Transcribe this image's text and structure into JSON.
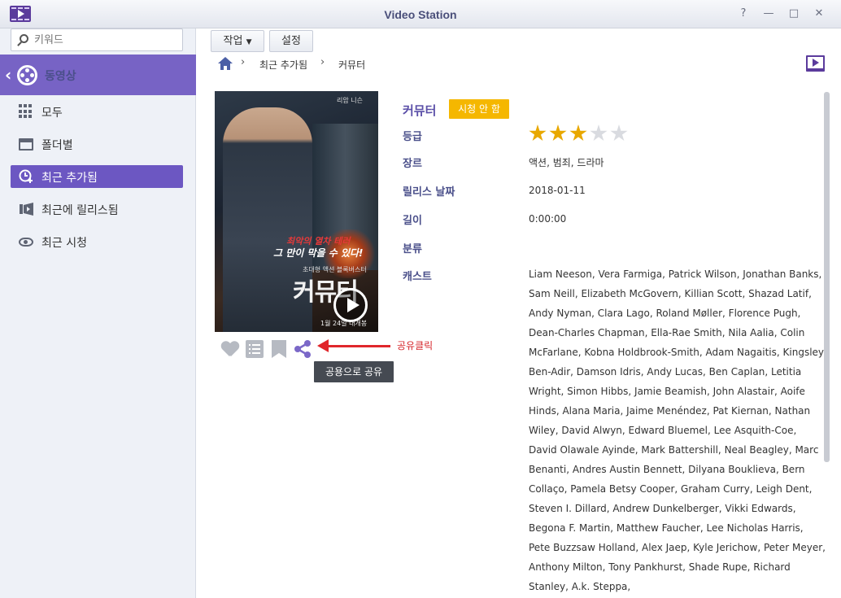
{
  "window": {
    "title": "Video Station",
    "controls": [
      "?",
      "—",
      "□",
      "✕"
    ]
  },
  "sidebar": {
    "search_placeholder": "키워드",
    "library": "동영상",
    "items": [
      {
        "label": "모두",
        "icon": "grid-icon",
        "active": false
      },
      {
        "label": "폴더별",
        "icon": "folder-icon",
        "active": false
      },
      {
        "label": "최근 추가됨",
        "icon": "recently-added-icon",
        "active": true
      },
      {
        "label": "최근에 릴리스됨",
        "icon": "recently-released-icon",
        "active": false
      },
      {
        "label": "최근 시청",
        "icon": "eye-icon",
        "active": false
      }
    ]
  },
  "toolbar": {
    "action_label": "작업",
    "settings_label": "설정"
  },
  "breadcrumb": {
    "items": [
      "최근 추가됨",
      "커뮤터"
    ]
  },
  "poster": {
    "cast_top": "리암 니슨",
    "tagline1": "최악의 열차 테러",
    "tagline2": "그 만이 막을 수 있다!",
    "tagline3": "초대형 액션 블록버스터",
    "title": "커뮤터",
    "release_note": "1월 24일 대개봉"
  },
  "actions": {
    "tooltip": "공용으로 공유",
    "annotation": "공유클릭"
  },
  "movie": {
    "title": "커뮤터",
    "watch_status": "시청 안 함",
    "rating": 3,
    "rating_max": 5,
    "labels": {
      "rating": "등급",
      "genre": "장르",
      "release_date": "릴리스 날짜",
      "length": "길이",
      "classification": "분류",
      "cast": "캐스트"
    },
    "genre": "액션, 범죄, 드라마",
    "release_date": "2018-01-11",
    "length": "0:00:00",
    "classification": "",
    "cast": "Liam Neeson, Vera Farmiga, Patrick Wilson, Jonathan Banks, Sam Neill, Elizabeth McGovern, Killian Scott, Shazad Latif, Andy Nyman, Clara Lago, Roland Møller, Florence Pugh, Dean-Charles Chapman, Ella-Rae Smith, Nila Aalia, Colin McFarlane, Kobna Holdbrook-Smith, Adam Nagaitis, Kingsley Ben-Adir, Damson Idris, Andy Lucas, Ben Caplan, Letitia Wright, Simon Hibbs, Jamie Beamish, John Alastair, Aoife Hinds, Alana Maria, Jaime Menéndez, Pat Kiernan, Nathan Wiley, David Alwyn, Edward Bluemel, Lee Asquith-Coe, David Olawale Ayinde, Mark Battershill, Neal Beagley, Marc Benanti, Andres Austin Bennett, Dilyana Bouklieva, Bern Collaço, Pamela Betsy Cooper, Graham Curry, Leigh Dent, Steven I. Dillard, Andrew Dunkelberger, Vikki Edwards, Begona F. Martin, Matthew Faucher, Lee Nicholas Harris, Pete Buzzsaw Holland, Alex Jaep, Kyle Jerichow, Peter Meyer, Anthony Milton, Tony Pankhurst, Shade Rupe, Richard Stanley, A.k. Steppa,"
  },
  "colors": {
    "accent": "#7763c5",
    "active_item": "#6c57c2",
    "badge": "#f5b700",
    "star_on": "#e8a800",
    "annotation": "#e0262b"
  }
}
